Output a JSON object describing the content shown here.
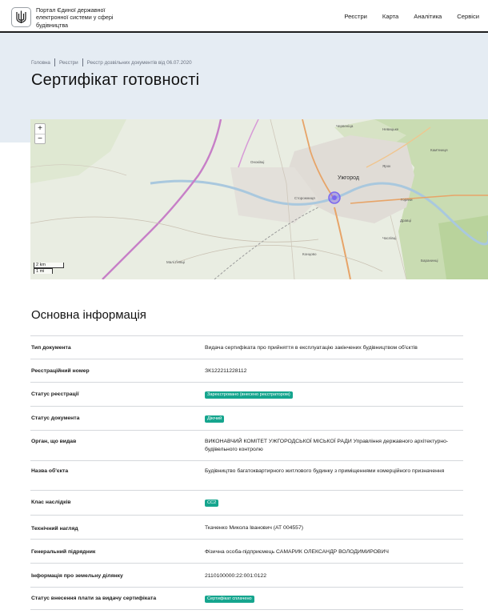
{
  "header": {
    "logo_text": "Портал Єдиної державної електронної системи у сфері будівництва",
    "nav": [
      "Реєстри",
      "Карта",
      "Аналітика",
      "Сервіси"
    ]
  },
  "breadcrumb": [
    "Головна",
    "Реєстри",
    "Реєстр дозвільних документів від 06.07.2020"
  ],
  "page_title": "Сертифікат готовності",
  "map": {
    "zoom_in": "+",
    "zoom_out": "−",
    "scale_km": "2 km",
    "scale_mi": "1 mi",
    "city_label": "Ужгород",
    "labels": [
      "Червеніца",
      "Невицьке",
      "Кам'яниця",
      "Оноківці",
      "Ярок",
      "Сторожниця",
      "Горяни",
      "Дравці",
      "Часлівці",
      "Баранинці",
      "Малі Ґеївці",
      "Концово"
    ]
  },
  "section_title": "Основна інформація",
  "rows": [
    {
      "label": "Тип документа",
      "value": "Видача сертифіката про прийняття в експлуатацію закінчених будівництвом об'єктів"
    },
    {
      "label": "Реєстраційний номер",
      "value": "ЗК122211228112"
    },
    {
      "label": "Статус реєстрації",
      "badge": "Зареєстровано (внесено реєстратором)"
    },
    {
      "label": "Статус документа",
      "badge": "Діючий"
    },
    {
      "label": "Орган, що видав",
      "value": "ВИКОНАВЧИЙ КОМІТЕТ УЖГОРОДСЬКОЇ МІСЬКОЇ РАДИ Управління державного архітектурно-будівельного контролю"
    },
    {
      "label": "Назва об'єкта",
      "value": "Будівництво багатоквартирного житлового будинку з приміщеннями комерційного призначення"
    },
    {
      "label": "Клас наслідків",
      "badge": "СС2"
    },
    {
      "label": "Технічний нагляд",
      "value": "Ткаченко Микола Іванович (АТ 004557)"
    },
    {
      "label": "Генеральний підрядник",
      "value": "Фізична особа-підприємець САМАРИК ОЛЕКСАНДР ВОЛОДИМИРОВИЧ"
    },
    {
      "label": "Інформація про земельну ділянку",
      "value": "2110100000:22:001:0122"
    },
    {
      "label": "Статус внесення плати за видачу сертифіката",
      "badge": "Сертифікат сплачено"
    }
  ],
  "colors": {
    "badge": "#15a58e",
    "hero_bg": "#e5ecf3",
    "marker": "#7b68ee"
  }
}
